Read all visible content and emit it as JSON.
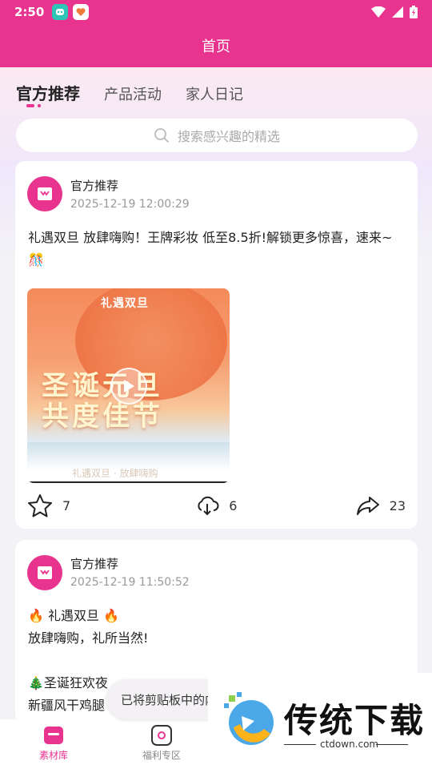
{
  "status_bar": {
    "time": "2:50"
  },
  "header": {
    "title": "首页"
  },
  "tabs": [
    {
      "label": "官方推荐",
      "active": true
    },
    {
      "label": "产品活动",
      "active": false
    },
    {
      "label": "家人日记",
      "active": false
    }
  ],
  "search": {
    "placeholder": "搜索感兴趣的精选"
  },
  "posts": [
    {
      "author": "官方推荐",
      "timestamp": "2025-12-19 12:00:29",
      "text": " 礼遇双旦  放肆嗨购！王牌彩妆 低至8.5折!解锁更多惊喜，速来~🎊",
      "video": {
        "top_label": "礼遇双旦",
        "headline_1": "圣诞元旦",
        "headline_2": "共度佳节",
        "caption": "礼遇双旦 · 放肆嗨购"
      },
      "likes": "7",
      "downloads": "6",
      "shares": "23"
    },
    {
      "author": "官方推荐",
      "timestamp": "2025-12-19 11:50:52",
      "text": "🔥 礼遇双旦 🔥\n放肆嗨购，礼所当然!\n\n🎄圣诞狂欢夜\n新疆风干鸡腿"
    }
  ],
  "bottom_nav": [
    {
      "label": "素材库",
      "active": true
    },
    {
      "label": "福利专区",
      "active": false
    }
  ],
  "toast": {
    "text": "已将剪贴板中的内"
  },
  "watermark": {
    "brand": "传统下载",
    "url": "ctdown.com"
  },
  "colors": {
    "accent": "#e8338f",
    "header_bg": "#e8338f"
  }
}
